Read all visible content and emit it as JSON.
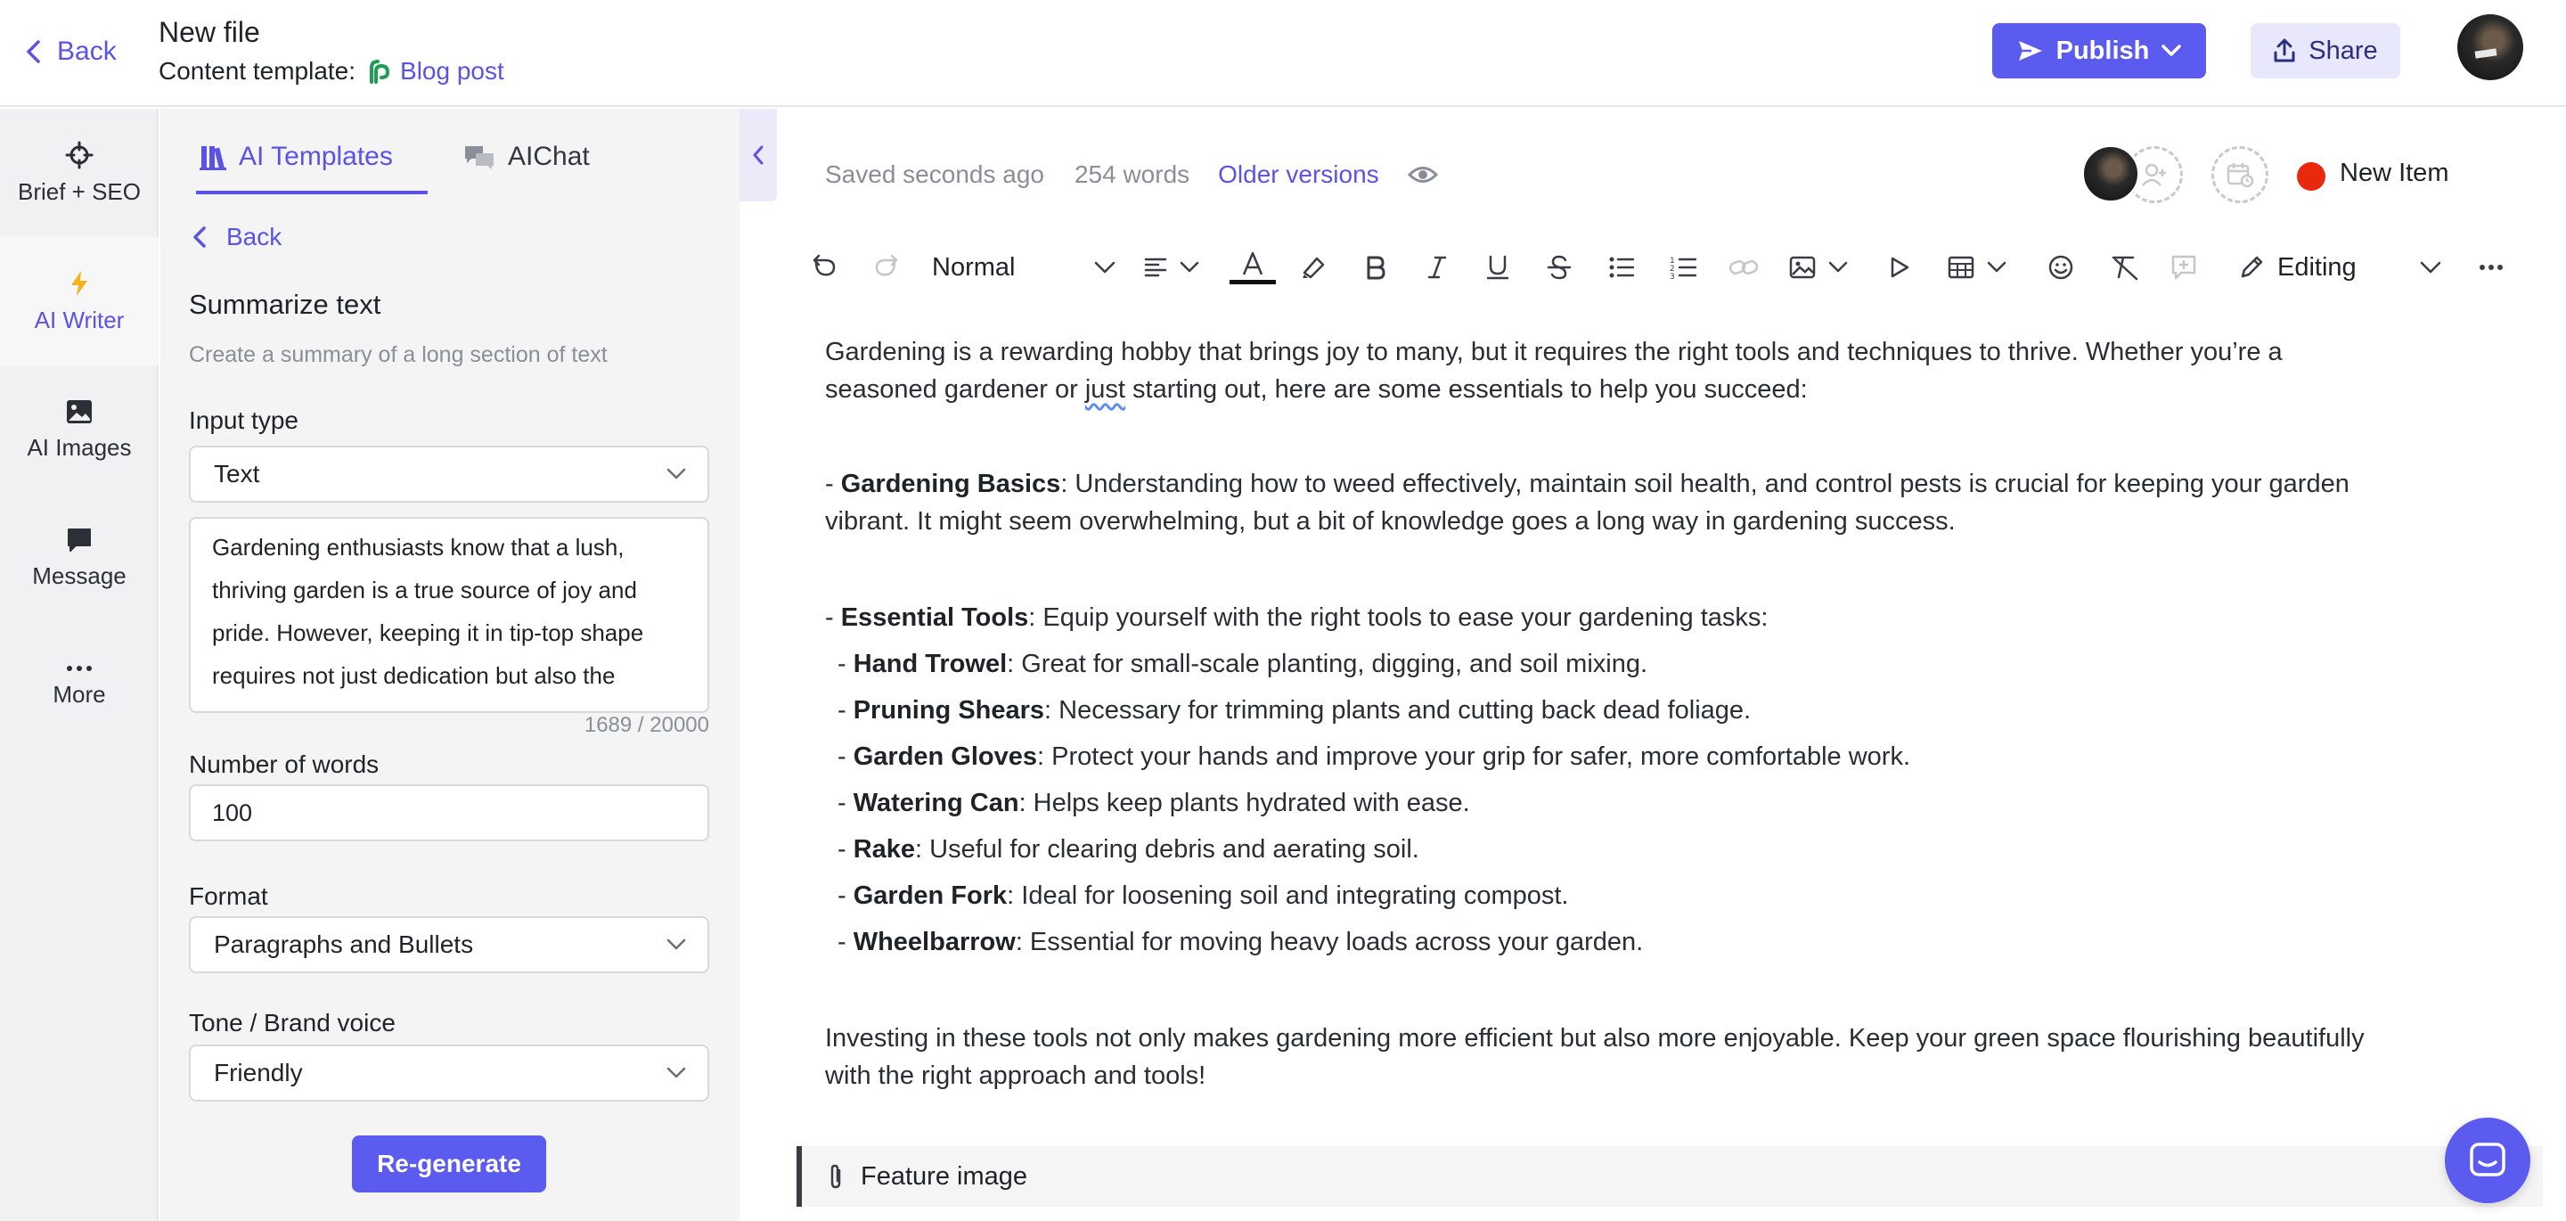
{
  "header": {
    "back_label": "Back",
    "file_title": "New file",
    "template_prefix": "Content template:",
    "template_name": "Blog post",
    "publish_label": "Publish",
    "share_label": "Share"
  },
  "rail": {
    "items": [
      {
        "label": "Brief + SEO",
        "icon": "crosshair-icon"
      },
      {
        "label": "AI Writer",
        "icon": "lightning-icon",
        "active": true
      },
      {
        "label": "AI Images",
        "icon": "image-icon"
      },
      {
        "label": "Message",
        "icon": "chat-bubble-icon"
      },
      {
        "label": "More",
        "icon": "ellipsis-icon"
      }
    ]
  },
  "panel": {
    "tabs": [
      {
        "label": "AI Templates",
        "active": true
      },
      {
        "label": "AIChat",
        "active": false
      }
    ],
    "back_label": "Back",
    "title": "Summarize text",
    "description": "Create a summary of a long section of text",
    "input_type": {
      "label": "Input type",
      "value": "Text"
    },
    "input_text": {
      "lines": [
        "Gardening enthusiasts know that a lush,",
        "thriving garden is a true source of joy and",
        "pride. However, keeping it in tip-top shape",
        "requires not just dedication but also the"
      ],
      "counter": "1689 / 20000"
    },
    "word_count": {
      "label": "Number of words",
      "value": "100"
    },
    "format": {
      "label": "Format",
      "value": "Paragraphs and Bullets"
    },
    "tone": {
      "label": "Tone / Brand voice",
      "value": "Friendly"
    },
    "regenerate_label": "Re-generate"
  },
  "editor": {
    "saved_status": "Saved seconds ago",
    "word_count": "254 words",
    "older_versions": "Older versions",
    "status_label": "New Item",
    "status_color": "#e8290e",
    "toolbar": {
      "block_style": "Normal",
      "mode": "Editing"
    },
    "content": {
      "p1_line1": "Gardening is a rewarding hobby that brings joy to many, but it requires the right tools and techniques to thrive. Whether you’re a",
      "p1_line2_a": "seasoned gardener or ",
      "p1_line2_b": "just",
      "p1_line2_c": " starting out, here are some essentials to help you succeed:",
      "basics_dash": "- ",
      "basics_term": "Gardening Basics",
      "basics_text": ": Understanding how to weed effectively, maintain soil health, and control pests is crucial for keeping your garden",
      "basics_line2": "vibrant. It might seem overwhelming, but a bit of knowledge goes a long way in gardening success.",
      "tools_dash": "- ",
      "tools_term": "Essential Tools",
      "tools_text": ": Equip yourself with the right tools to ease your gardening tasks:",
      "tools": [
        {
          "name": "Hand Trowel",
          "desc": ": Great for small-scale planting, digging, and soil mixing."
        },
        {
          "name": "Pruning Shears",
          "desc": ": Necessary for trimming plants and cutting back dead foliage."
        },
        {
          "name": "Garden Gloves",
          "desc": ": Protect your hands and improve your grip for safer, more comfortable work."
        },
        {
          "name": "Watering Can",
          "desc": ": Helps keep plants hydrated with ease."
        },
        {
          "name": "Rake",
          "desc": ": Useful for clearing debris and aerating soil."
        },
        {
          "name": "Garden Fork",
          "desc": ": Ideal for loosening soil and integrating compost."
        },
        {
          "name": "Wheelbarrow",
          "desc": ": Essential for moving heavy loads across your garden."
        }
      ],
      "closing_line1": "Investing in these tools not only makes gardening more efficient but also more enjoyable. Keep your green space flourishing beautifully",
      "closing_line2": "with the right approach and tools!"
    },
    "feature_image_label": "Feature image"
  },
  "colors": {
    "accent": "#5b5bf0",
    "accent_text": "#5b52e6"
  }
}
